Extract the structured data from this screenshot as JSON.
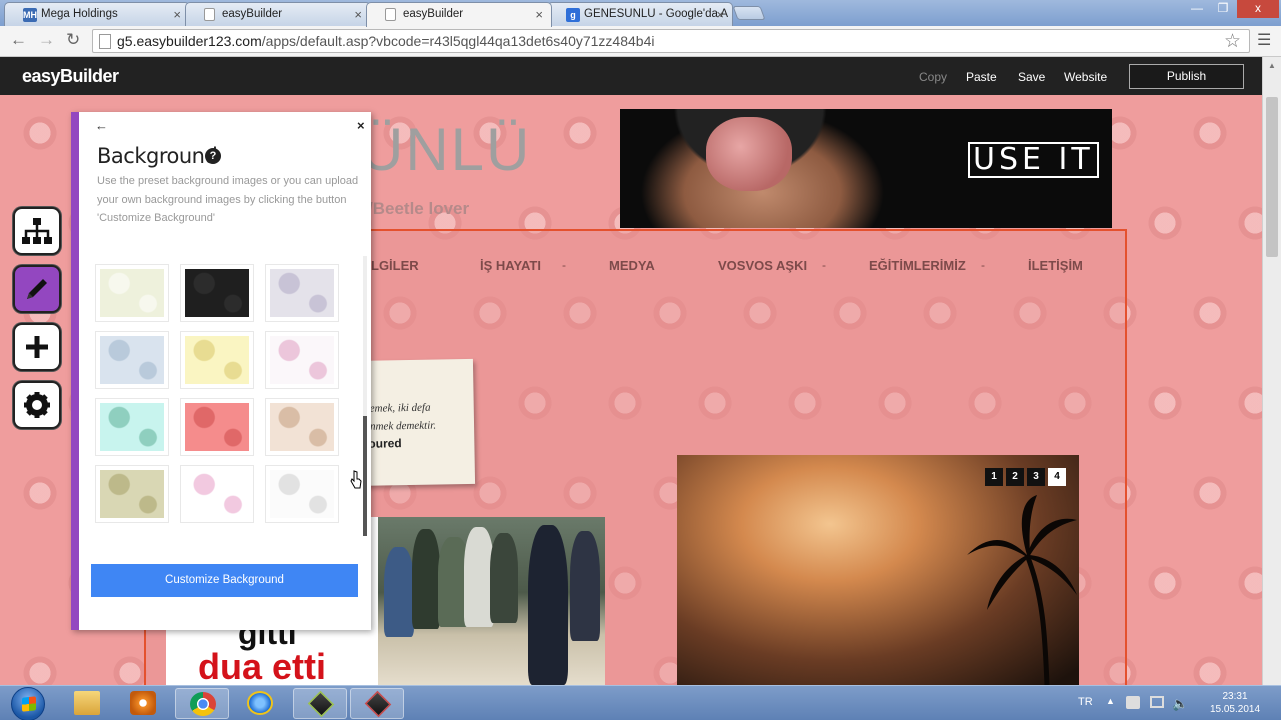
{
  "browser": {
    "tabs": [
      {
        "label": "Mega Holdings",
        "icon": "MH",
        "active": false
      },
      {
        "label": "easyBuilder",
        "icon": "",
        "active": false
      },
      {
        "label": "easyBuilder",
        "icon": "",
        "active": true
      },
      {
        "label": "GENESUNLU - Google'da A",
        "icon": "g",
        "active": false
      }
    ],
    "url_host": "g5.easybuilder123.com",
    "url_path": "/apps/default.asp?vbcode=r43l5qgl44qa13det6s40y71zz484b4i",
    "window_controls": [
      "—",
      "❐",
      "x"
    ]
  },
  "app": {
    "logo": "easyBuilder",
    "menu": [
      {
        "label": "Copy",
        "disabled": true
      },
      {
        "label": "Paste",
        "disabled": false
      },
      {
        "label": "Save",
        "disabled": false
      },
      {
        "label": "Website",
        "disabled": false
      }
    ],
    "publish_label": "Publish"
  },
  "tools": [
    {
      "name": "sitemap",
      "glyph": "☷"
    },
    {
      "name": "edit",
      "glyph": "✎"
    },
    {
      "name": "add",
      "glyph": "+"
    },
    {
      "name": "settings",
      "glyph": "⚙"
    }
  ],
  "panel": {
    "back_glyph": "←",
    "close_glyph": "×",
    "title": "Background",
    "help_glyph": "?",
    "description": "Use the preset background images or you can upload your own background images by clicking the button 'Customize Background'",
    "button_label": "Customize Background",
    "swatches": [
      {
        "color": "#eef1dc",
        "pattern": "#f7f8ee"
      },
      {
        "color": "#1f1f1f",
        "pattern": "#2c2c2c"
      },
      {
        "color": "#e4e2ea",
        "pattern": "#c8c3d6"
      },
      {
        "color": "#d9e3ee",
        "pattern": "#b9cadb"
      },
      {
        "color": "#faf5c2",
        "pattern": "#e8dc92"
      },
      {
        "color": "#fbf7fa",
        "pattern": "#ecc6db"
      },
      {
        "color": "#c8f4ee",
        "pattern": "#8fcfbf"
      },
      {
        "color": "#f58c8c",
        "pattern": "#e06868"
      },
      {
        "color": "#f2e2d5",
        "pattern": "#d9bda6"
      },
      {
        "color": "#d9d7b4",
        "pattern": "#bdb98a"
      },
      {
        "color": "#ffffff",
        "pattern": "#f2c9e0"
      },
      {
        "color": "#fbfbfb",
        "pattern": "#e2e2e2"
      }
    ]
  },
  "site": {
    "title_fragment": "ÜNLÜ",
    "subtitle_fragment": "/Beetle lover",
    "hero_logo": "USE IT",
    "nav": [
      "LGİLER",
      "İŞ HAYATI",
      "MEDYA",
      "VOSVOS AŞKI",
      "EĞİTİMLERİMİZ",
      "İLETİŞİM"
    ],
    "note_lines": [
      "emek, iki defa",
      "nmek demektir."
    ],
    "note_author": "oured",
    "headline_top": "gitti",
    "headline_bottom": "dua etti",
    "slider_pages": [
      "1",
      "2",
      "3",
      "4"
    ],
    "slider_active": "4"
  },
  "taskbar": {
    "language": "TR",
    "time": "23:31",
    "date": "15.05.2014"
  }
}
